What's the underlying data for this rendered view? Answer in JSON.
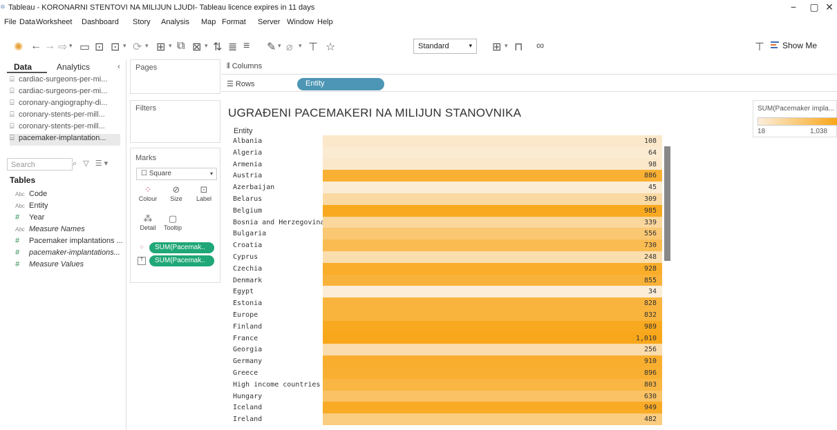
{
  "window": {
    "title": "Tableau - KORONARNI STENTOVI NA MILIJUN LJUDI- Tableau licence expires in 11 days",
    "minimize": "−",
    "restore": "▢",
    "close": "✕"
  },
  "menu": [
    "File",
    "Data",
    "Worksheet",
    "Dashboard",
    "Story",
    "Analysis",
    "Map",
    "Format",
    "Server",
    "Window",
    "Help"
  ],
  "toolbar": {
    "fit_select": "Standard",
    "show_me": "Show Me"
  },
  "left_pane": {
    "tabs": [
      "Data",
      "Analytics"
    ],
    "data_sources": [
      "cardiac-surgeons-per-mi...",
      "cardiac-surgeons-per-mi...",
      "coronary-angiography-di...",
      "coronary-stents-per-mill...",
      "coronary-stents-per-mill...",
      "pacemaker-implantation..."
    ],
    "search_placeholder": "Search",
    "tables_heading": "Tables",
    "fields": [
      {
        "type": "Abc",
        "name": "Code"
      },
      {
        "type": "Abc",
        "name": "Entity"
      },
      {
        "type": "#",
        "name": "Year"
      },
      {
        "type": "Abc",
        "name": "Measure Names"
      },
      {
        "type": "#",
        "name": "Pacemaker implantations ..."
      },
      {
        "type": "#",
        "name": "pacemaker-implantations..."
      },
      {
        "type": "#",
        "name": "Measure Values"
      }
    ]
  },
  "cards": {
    "pages": "Pages",
    "filters": "Filters",
    "marks": "Marks",
    "mark_type": "Square",
    "mark_buttons": [
      "Colour",
      "Size",
      "Label",
      "Detail",
      "Tooltip"
    ],
    "mark_pills": [
      "SUM(Pacemak..",
      "SUM(Pacemak.."
    ]
  },
  "shelves": {
    "columns_label": "Columns",
    "rows_label": "Rows",
    "rows_pill": "Entity"
  },
  "sheet": {
    "title": "UGRAĐENI PACEMAKERI NA MILIJUN STANOVNIKA",
    "row_header": "Entity"
  },
  "legend": {
    "title": "SUM(Pacemaker impla...",
    "min": "18",
    "max": "1,038",
    "color_low": "#fbeedb",
    "color_high": "#f9a515"
  },
  "chart_data": {
    "type": "table",
    "title": "UGRAĐENI PACEMAKERI NA MILIJUN STANOVNIKA",
    "column_header": "Entity",
    "color_range": [
      18,
      1038
    ],
    "rows": [
      {
        "entity": "Albania",
        "value": 108,
        "label": "108"
      },
      {
        "entity": "Algeria",
        "value": 64,
        "label": "64"
      },
      {
        "entity": "Armenia",
        "value": 98,
        "label": "98"
      },
      {
        "entity": "Austria",
        "value": 886,
        "label": "886"
      },
      {
        "entity": "Azerbaijan",
        "value": 45,
        "label": "45"
      },
      {
        "entity": "Belarus",
        "value": 309,
        "label": "309"
      },
      {
        "entity": "Belgium",
        "value": 985,
        "label": "985"
      },
      {
        "entity": "Bosnia and Herzegovina",
        "value": 339,
        "label": "339"
      },
      {
        "entity": "Bulgaria",
        "value": 556,
        "label": "556"
      },
      {
        "entity": "Croatia",
        "value": 730,
        "label": "730"
      },
      {
        "entity": "Cyprus",
        "value": 248,
        "label": "248"
      },
      {
        "entity": "Czechia",
        "value": 928,
        "label": "928"
      },
      {
        "entity": "Denmark",
        "value": 855,
        "label": "855"
      },
      {
        "entity": "Egypt",
        "value": 34,
        "label": "34"
      },
      {
        "entity": "Estonia",
        "value": 828,
        "label": "828"
      },
      {
        "entity": "Europe",
        "value": 832,
        "label": "832"
      },
      {
        "entity": "Finland",
        "value": 989,
        "label": "989"
      },
      {
        "entity": "France",
        "value": 1010,
        "label": "1,010"
      },
      {
        "entity": "Georgia",
        "value": 256,
        "label": "256"
      },
      {
        "entity": "Germany",
        "value": 910,
        "label": "910"
      },
      {
        "entity": "Greece",
        "value": 896,
        "label": "896"
      },
      {
        "entity": "High income countries (Eu..",
        "value": 803,
        "label": "803"
      },
      {
        "entity": "Hungary",
        "value": 630,
        "label": "630"
      },
      {
        "entity": "Iceland",
        "value": 949,
        "label": "949"
      },
      {
        "entity": "Ireland",
        "value": 482,
        "label": "482"
      }
    ]
  }
}
